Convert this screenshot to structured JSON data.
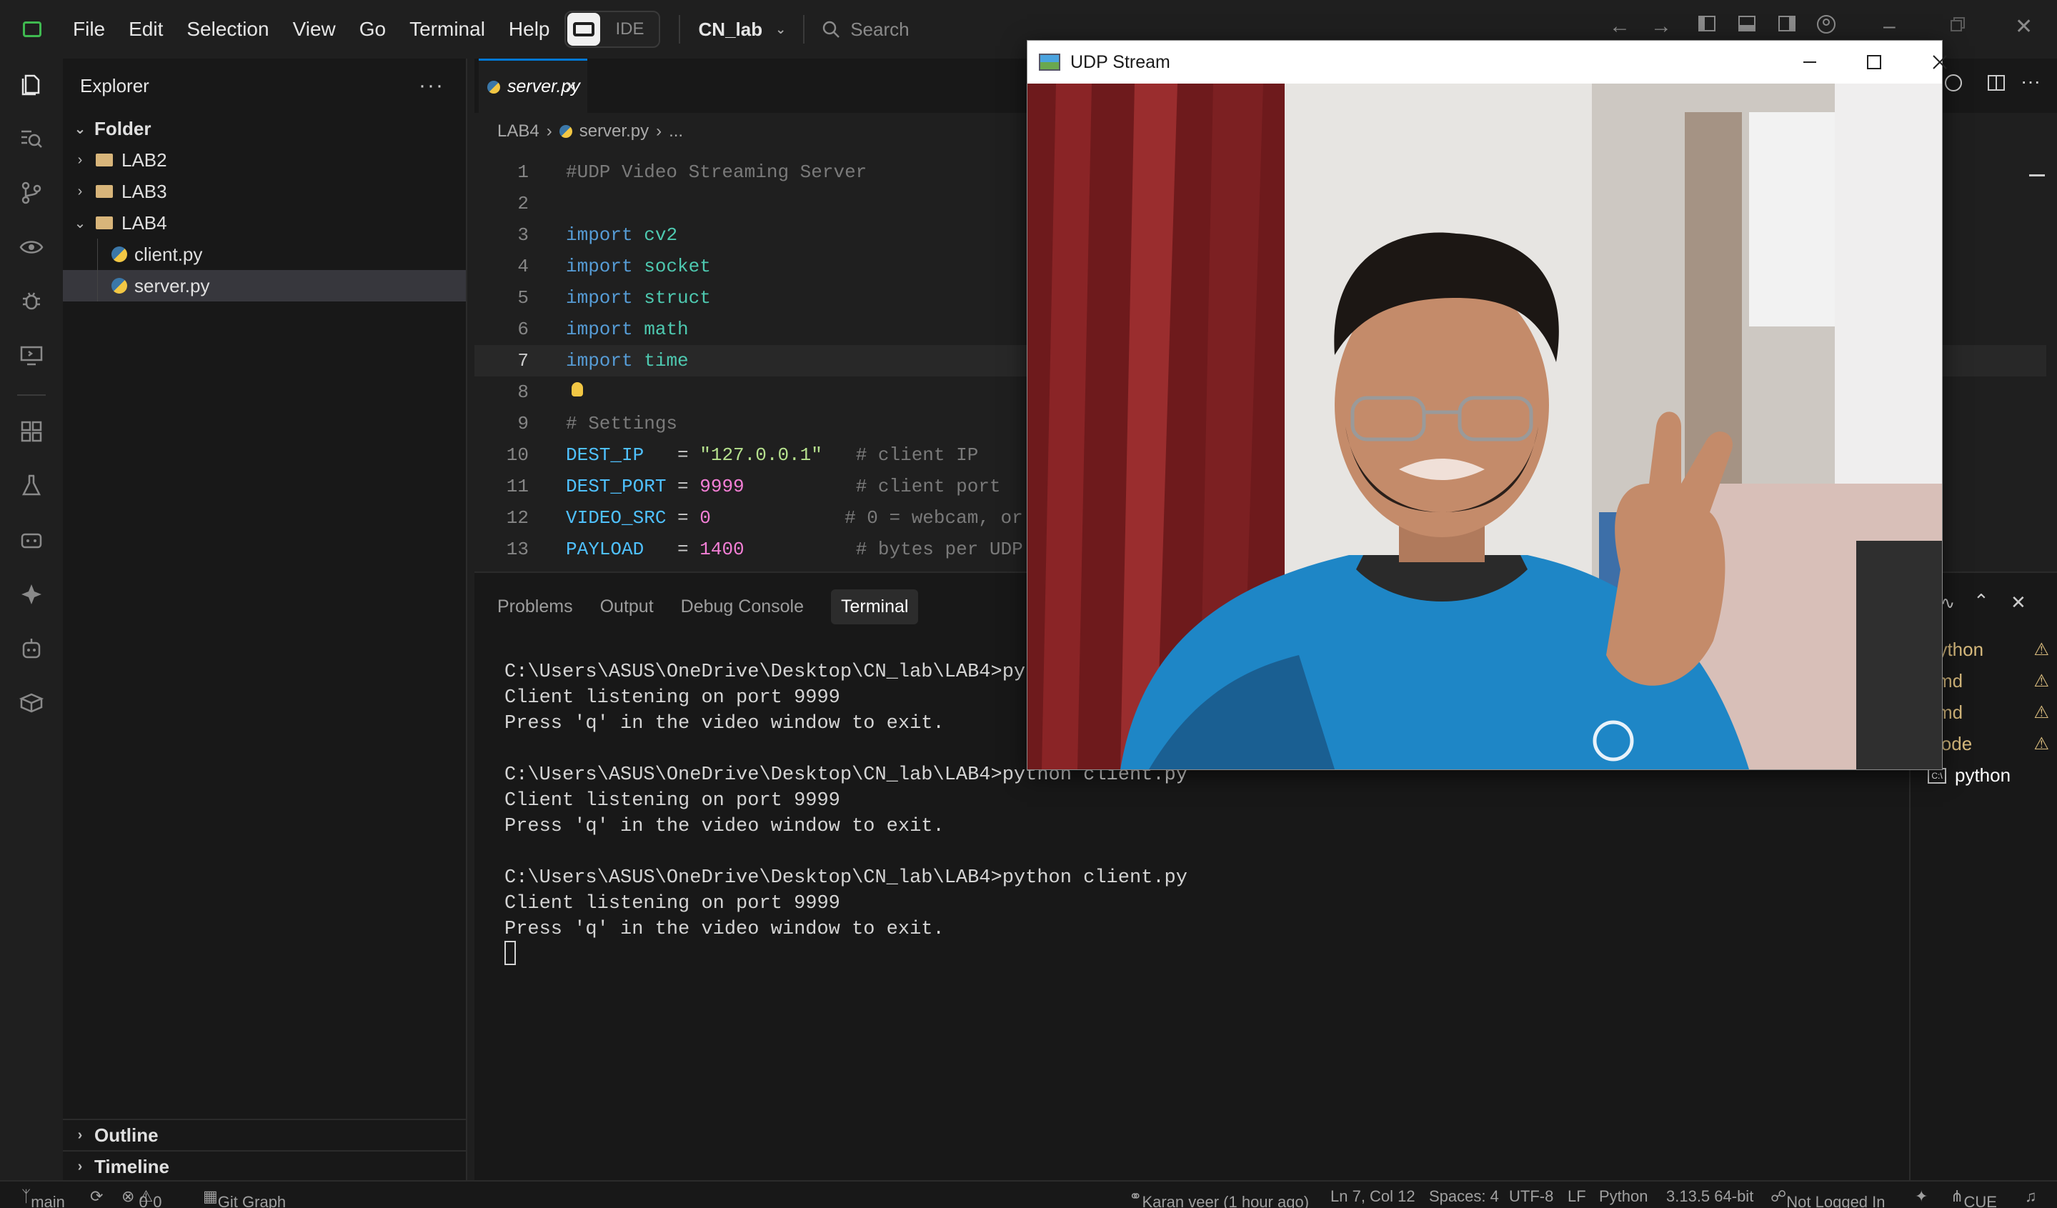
{
  "menu": [
    "File",
    "Edit",
    "Selection",
    "View",
    "Go",
    "Terminal",
    "Help"
  ],
  "ide_label": "IDE",
  "workspace": "CN_lab",
  "search_placeholder": "Search",
  "sidebar": {
    "title": "Explorer",
    "root": "Folder",
    "items": [
      {
        "label": "LAB2",
        "type": "folder"
      },
      {
        "label": "LAB3",
        "type": "folder"
      },
      {
        "label": "LAB4",
        "type": "folder"
      },
      {
        "label": "client.py",
        "type": "file"
      },
      {
        "label": "server.py",
        "type": "file",
        "selected": true
      }
    ],
    "outline": "Outline",
    "timeline": "Timeline"
  },
  "editor": {
    "tab": "server.py",
    "breadcrumb": [
      "LAB4",
      "server.py",
      "..."
    ],
    "lines": [
      {
        "n": "1",
        "text": "#UDP Video Streaming Server"
      },
      {
        "n": "2",
        "text": ""
      },
      {
        "n": "3",
        "text": "import cv2"
      },
      {
        "n": "4",
        "text": "import socket"
      },
      {
        "n": "5",
        "text": "import struct"
      },
      {
        "n": "6",
        "text": "import math"
      },
      {
        "n": "7",
        "text": "import time"
      },
      {
        "n": "8",
        "text": ""
      },
      {
        "n": "9",
        "text": "# Settings"
      },
      {
        "n": "10",
        "text": "DEST_IP   = \"127.0.0.1\"   # client IP"
      },
      {
        "n": "11",
        "text": "DEST_PORT = 9999          # client port"
      },
      {
        "n": "12",
        "text": "VIDEO_SRC = 0            # 0 = webcam, or"
      },
      {
        "n": "13",
        "text": "PAYLOAD   = 1400          # bytes per UDP"
      }
    ]
  },
  "panel": {
    "tabs": [
      "Problems",
      "Output",
      "Debug Console",
      "Terminal"
    ],
    "active_tab": "Terminal",
    "terminal_lines": [
      "C:\\Users\\ASUS\\OneDrive\\Desktop\\CN_lab\\LAB4>pyt",
      "Client listening on port 9999",
      "Press 'q' in the video window to exit.",
      "",
      "C:\\Users\\ASUS\\OneDrive\\Desktop\\CN_lab\\LAB4>python client.py",
      "Client listening on port 9999",
      "Press 'q' in the video window to exit.",
      "",
      "C:\\Users\\ASUS\\OneDrive\\Desktop\\CN_lab\\LAB4>python client.py",
      "Client listening on port 9999",
      "Press 'q' in the video window to exit."
    ],
    "terminals": [
      "python",
      "cmd",
      "cmd",
      "Code",
      "python"
    ]
  },
  "status": {
    "branch": "main",
    "errors": "0",
    "warnings": "0",
    "git_graph": "Git Graph",
    "blame": "Karan veer (1 hour ago)",
    "position": "Ln 7, Col 12",
    "spaces": "Spaces: 4",
    "encoding": "UTF-8",
    "eol": "LF",
    "language": "Python",
    "interpreter": "3.13.5 64-bit",
    "login": "Not Logged In",
    "cue": "CUE"
  },
  "udp_window": {
    "title": "UDP Stream"
  },
  "colors": {
    "accent": "#0078d4",
    "warning": "#d7ba7d",
    "background": "#1f1f1f"
  }
}
